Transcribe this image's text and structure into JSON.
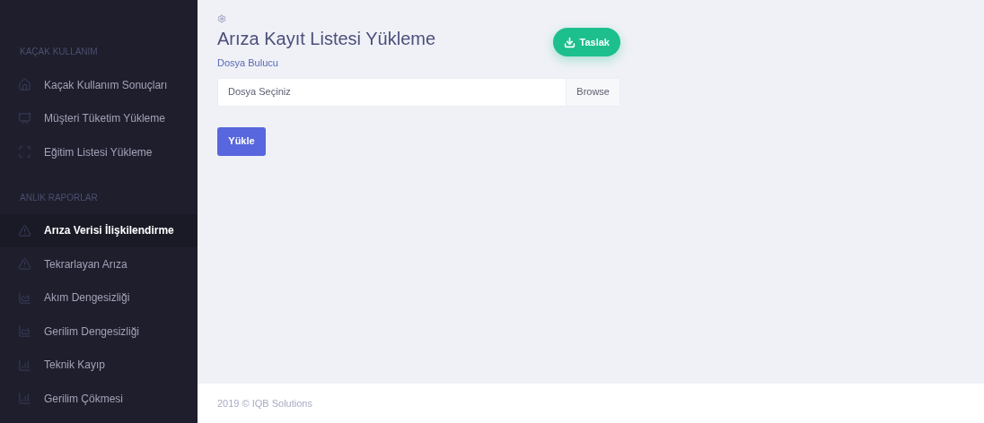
{
  "sidebar": {
    "sections": [
      {
        "heading": "KAÇAK KULLANIM",
        "items": [
          {
            "label": "Kaçak Kullanım Sonuçları",
            "kind": "home",
            "selected": false
          },
          {
            "label": "Müşteri Tüketim Yükleme",
            "kind": "presentation",
            "selected": false
          },
          {
            "label": "Eğitim Listesi Yükleme",
            "kind": "frame",
            "selected": false
          }
        ]
      },
      {
        "heading": "ANLIK RAPORLAR",
        "items": [
          {
            "label": "Arıza Verisi İlişkilendirme",
            "kind": "warning",
            "selected": true
          },
          {
            "label": "Tekrarlayan Arıza",
            "kind": "warning",
            "selected": false
          },
          {
            "label": "Akım Dengesizliği",
            "kind": "area",
            "selected": false
          },
          {
            "label": "Gerilim Dengesizliği",
            "kind": "area",
            "selected": false
          },
          {
            "label": "Teknik Kayıp",
            "kind": "bars",
            "selected": false
          },
          {
            "label": "Gerilim Çökmesi",
            "kind": "bars",
            "selected": false
          }
        ]
      }
    ]
  },
  "page": {
    "title": "Arıza Kayıt Listesi Yükleme",
    "template_button": "Taslak",
    "field_label": "Dosya Bulucu",
    "file_input": {
      "placeholder": "Dosya Seçiniz",
      "browse": "Browse"
    },
    "upload_button": "Yükle"
  },
  "footer": "2019 © IQB Solutions"
}
